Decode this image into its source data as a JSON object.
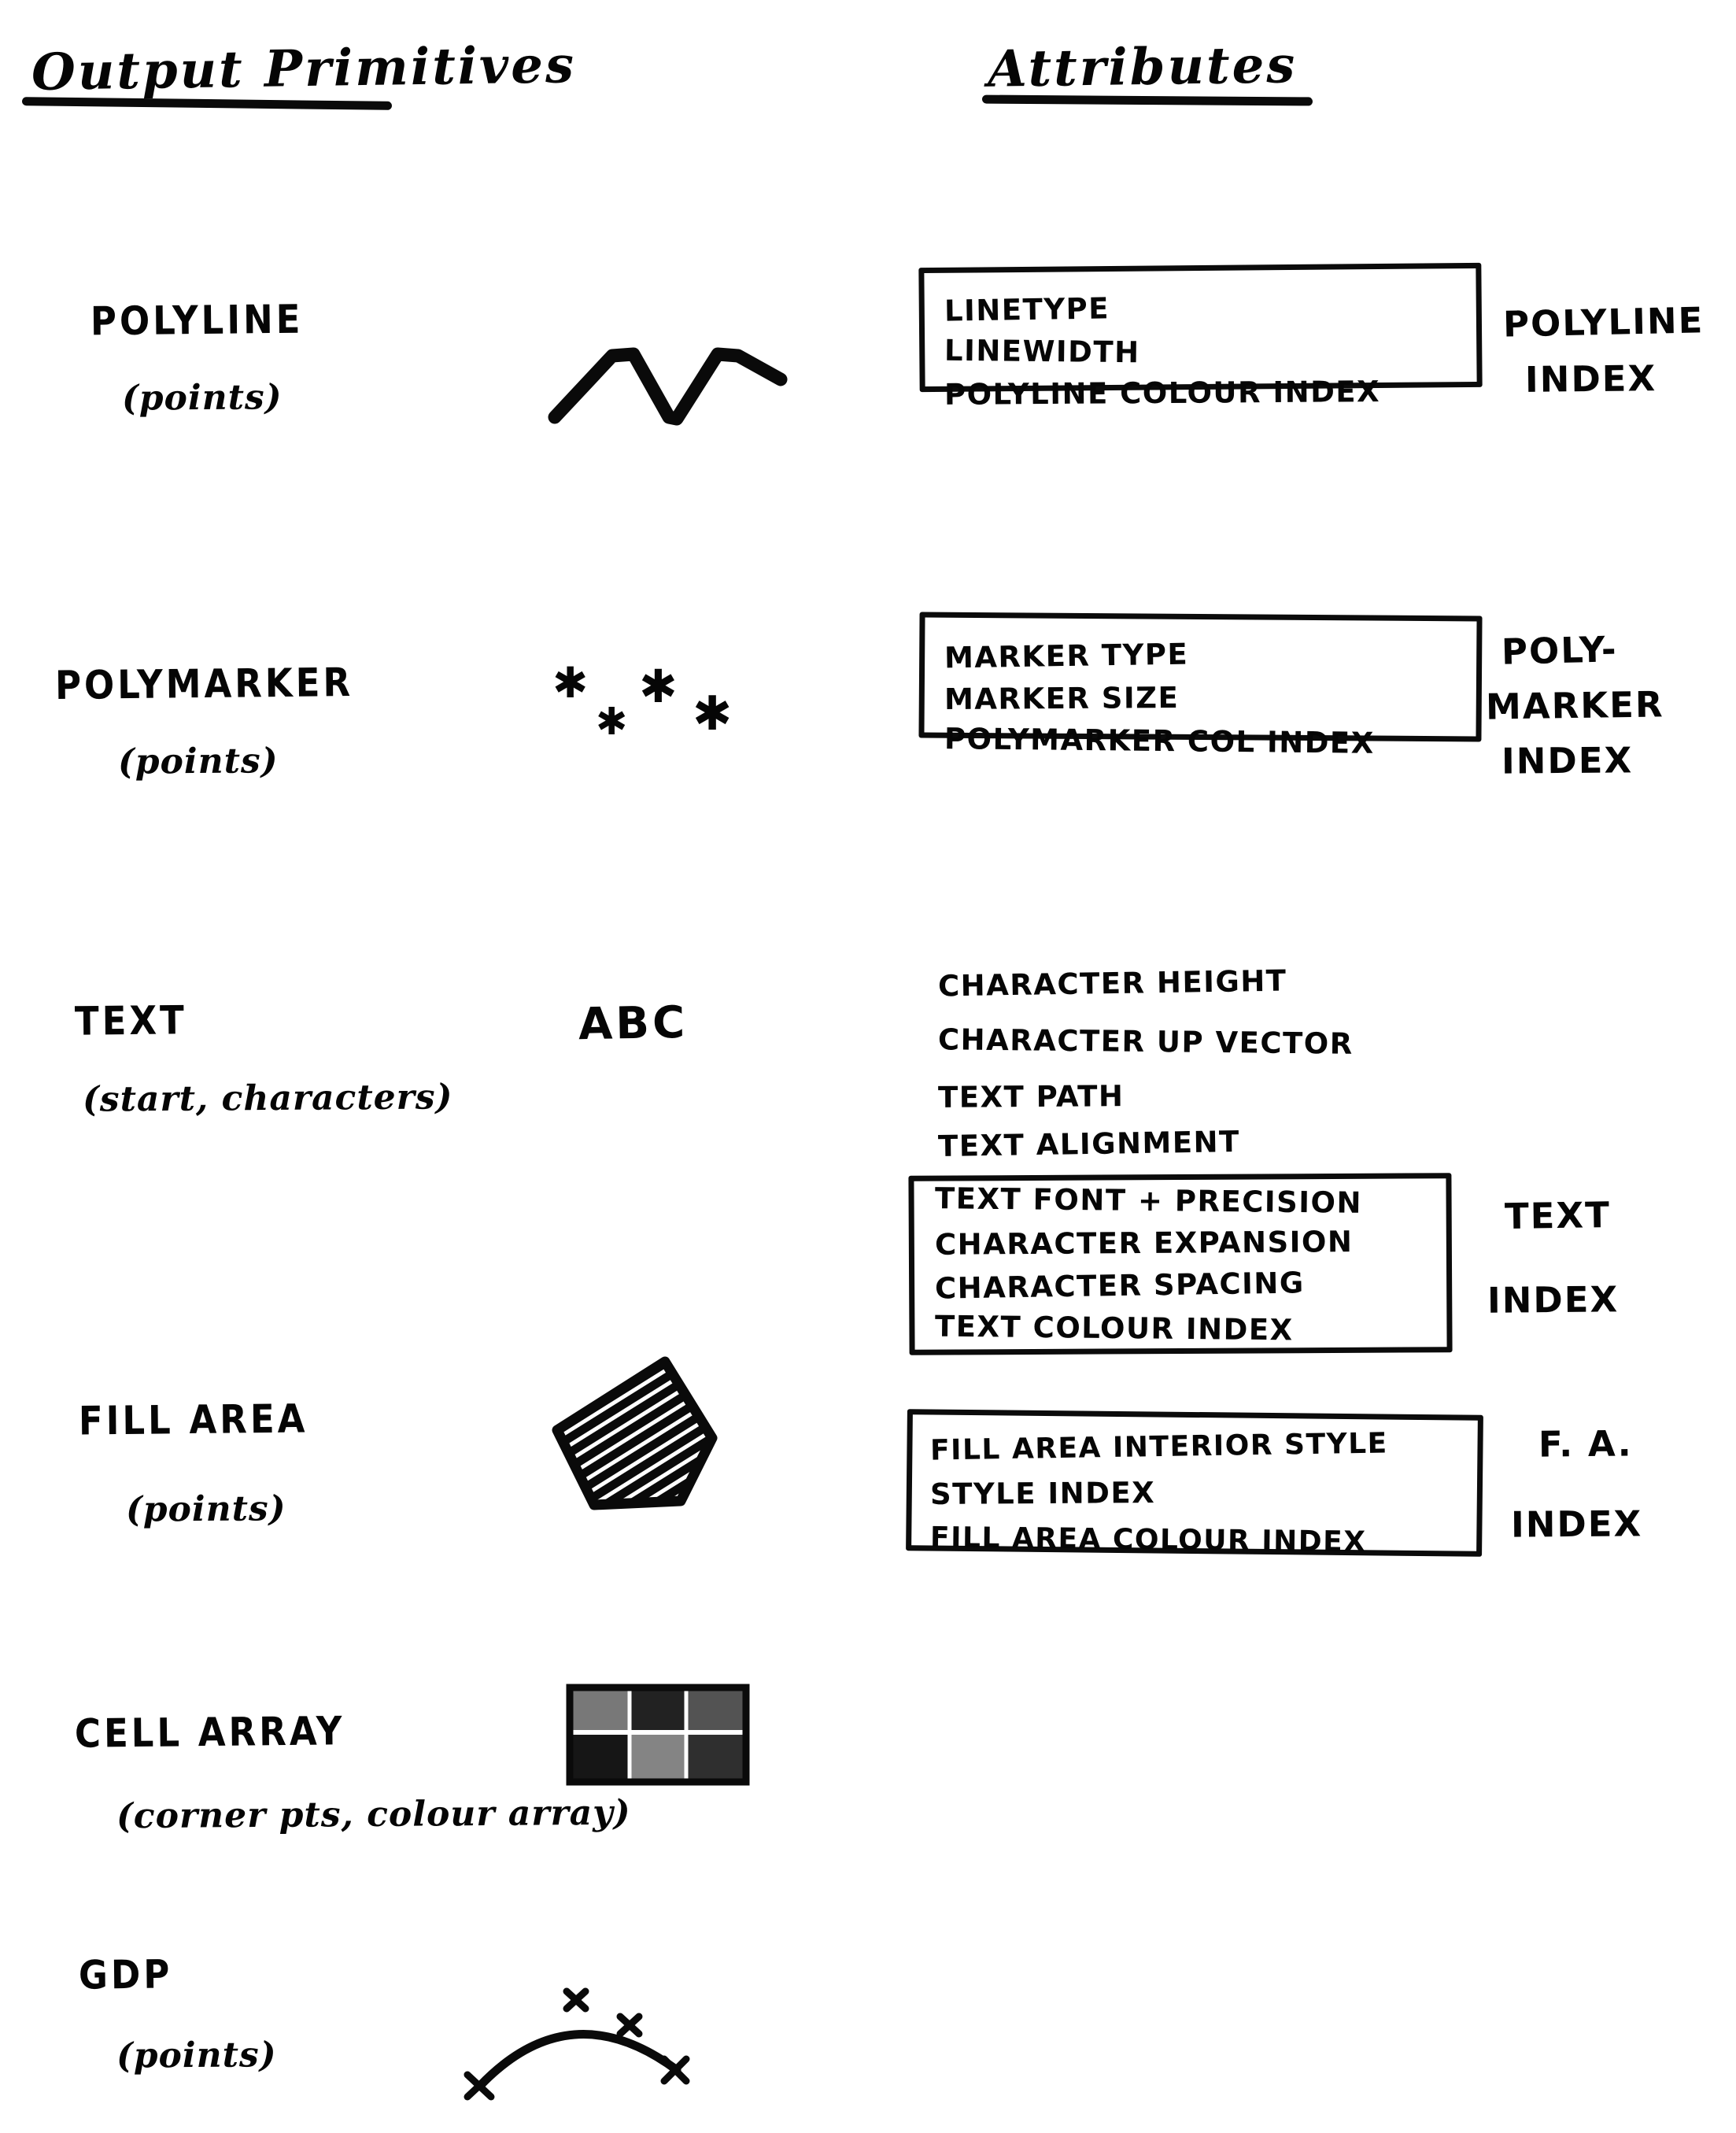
{
  "headers": {
    "left": "Output  Primitives",
    "right": "Attributes"
  },
  "primitives": [
    {
      "name": "POLYLINE",
      "args": "(points)",
      "icon": "zigzag-polyline-icon"
    },
    {
      "name": "POLYMARKER",
      "args": "(points)",
      "icon": "asterisk-markers-icon"
    },
    {
      "name": "TEXT",
      "args": "(start, characters)",
      "icon": "abc-text-icon",
      "icon_text": "ABC"
    },
    {
      "name": "FILL AREA",
      "args": "(points)",
      "icon": "hatched-pentagon-icon"
    },
    {
      "name": "CELL ARRAY",
      "args": "(corner pts, colour array)",
      "icon": "cell-grid-icon"
    },
    {
      "name": "GDP",
      "args": "(points)",
      "icon": "arc-curve-icon"
    }
  ],
  "attribute_groups": [
    {
      "boxed": true,
      "lines": [
        "LINETYPE",
        "LINEWIDTH",
        "POLYLINE COLOUR INDEX"
      ],
      "index_lines": [
        "POLYLINE",
        "INDEX"
      ]
    },
    {
      "boxed": true,
      "lines": [
        "MARKER TYPE",
        "MARKER SIZE",
        "POLYMARKER COL INDEX"
      ],
      "index_lines": [
        "POLY-",
        "MARKER",
        "INDEX"
      ]
    },
    {
      "boxed": false,
      "lines": [
        "CHARACTER HEIGHT",
        "CHARACTER UP VECTOR",
        "TEXT PATH",
        "TEXT ALIGNMENT"
      ],
      "index_lines": []
    },
    {
      "boxed": true,
      "lines": [
        "TEXT FONT + PRECISION",
        "CHARACTER EXPANSION",
        "CHARACTER SPACING",
        "TEXT COLOUR INDEX"
      ],
      "index_lines": [
        "TEXT",
        "INDEX"
      ]
    },
    {
      "boxed": true,
      "lines": [
        "FILL AREA INTERIOR STYLE",
        "STYLE INDEX",
        "FILL AREA COLOUR INDEX"
      ],
      "index_lines": [
        "F. A.",
        "INDEX"
      ]
    }
  ],
  "colors": {
    "ink": "#0a0a0a",
    "paper": "#ffffff"
  }
}
